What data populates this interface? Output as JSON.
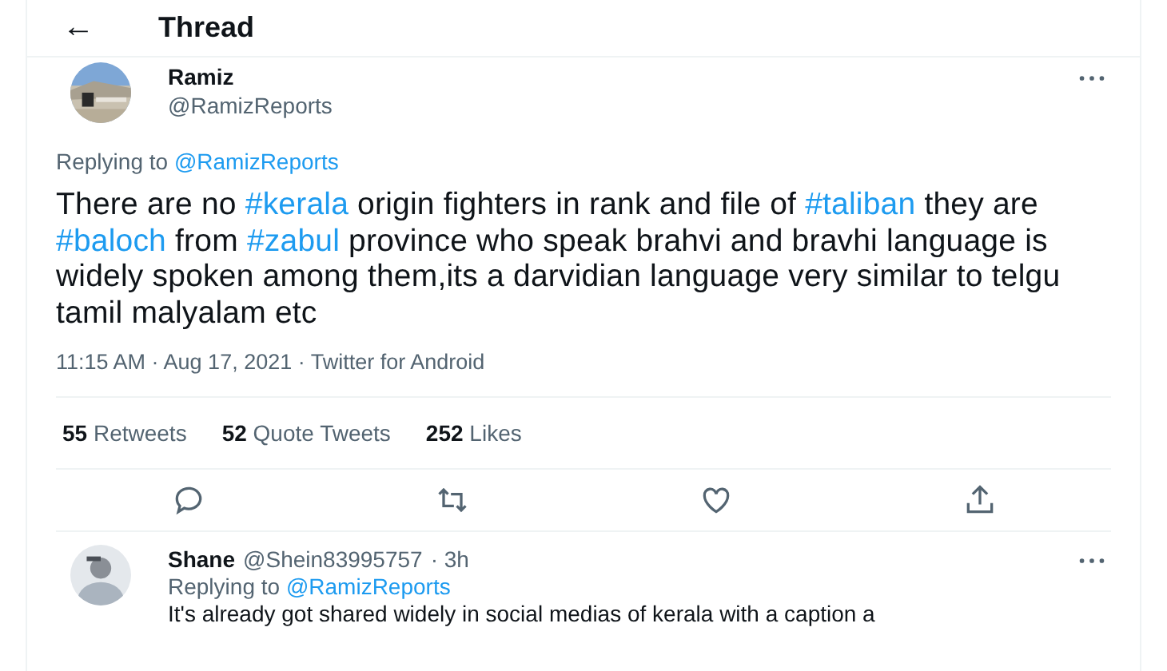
{
  "header": {
    "back_icon": "←",
    "title": "Thread"
  },
  "tweet": {
    "name": "Ramiz",
    "handle": "@RamizReports",
    "replying_label": "Replying to",
    "replying_to": "@RamizReports",
    "text": [
      {
        "kind": "plain",
        "text": "There are no "
      },
      {
        "kind": "hashtag",
        "text": "#kerala"
      },
      {
        "kind": "plain",
        "text": " origin fighters in rank and file of "
      },
      {
        "kind": "hashtag",
        "text": "#taliban"
      },
      {
        "kind": "plain",
        "text": " they are "
      },
      {
        "kind": "hashtag",
        "text": "#baloch"
      },
      {
        "kind": "plain",
        "text": " from "
      },
      {
        "kind": "hashtag",
        "text": "#zabul"
      },
      {
        "kind": "plain",
        "text": " province who speak brahvi and bravhi language is widely spoken among them,its a darvidian language very similar to telgu tamil malyalam etc"
      }
    ],
    "meta": "11:15 AM · Aug 17, 2021 · Twitter for Android",
    "stats": [
      {
        "count": "55",
        "label": "Retweets"
      },
      {
        "count": "52",
        "label": "Quote Tweets"
      },
      {
        "count": "252",
        "label": "Likes"
      }
    ],
    "actions": [
      {
        "kind": "reply"
      },
      {
        "kind": "retweet"
      },
      {
        "kind": "like"
      },
      {
        "kind": "share"
      }
    ]
  },
  "reply": {
    "name": "Shane",
    "handle": "@Shein83995757",
    "time": "· 3h",
    "replying_label": "Replying to",
    "replying_to": "@RamizReports",
    "text": "It's already got shared widely in social medias of kerala with a caption a"
  }
}
